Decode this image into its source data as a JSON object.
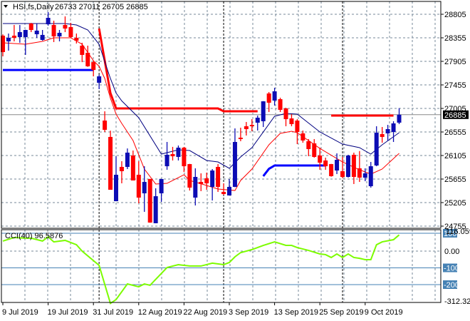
{
  "header": {
    "symbol": "HSI,fs,Daily",
    "ohlc": "26733 27011 26705 26885"
  },
  "cci_label": "CCI(40) 96.5876",
  "colors": {
    "bull": "#0c0cb4",
    "bear": "#ff0000",
    "ma_slow": "#000080",
    "ma_fast": "#ff0000",
    "cci": "#7cfc00",
    "level": "#4682b4",
    "grid": "#778899"
  },
  "chart_data": [
    {
      "type": "candlestick",
      "title": "HSI,fs,Daily",
      "yaxis_ticks": [
        28805,
        28355,
        27905,
        27455,
        27005,
        26555,
        26105,
        25655,
        25205,
        24755
      ],
      "ylim": [
        24755,
        28805
      ],
      "current_price": "26885",
      "grid": true,
      "x_tick_labels": [
        [
          "2019-07-09",
          "9 Jul 2019"
        ],
        [
          "2019-07-19",
          "19 Jul 2019"
        ],
        [
          "2019-07-31",
          "31 Jul 2019"
        ],
        [
          "2019-08-12",
          "12 Aug 2019"
        ],
        [
          "2019-08-22",
          "22 Aug 2019"
        ],
        [
          "2019-09-03",
          "3 Sep 2019"
        ],
        [
          "2019-09-13",
          "13 Sep 2019"
        ],
        [
          "2019-09-25",
          "25 Sep 2019"
        ],
        [
          "2019-10-09",
          "9 Oct 2019"
        ]
      ],
      "period_separators": [
        "2019-08-01",
        "2019-09-02",
        "2019-10-02"
      ],
      "candles_ohlc": [
        [
          "2019-07-09",
          28396,
          28420,
          28000,
          28082
        ],
        [
          "2019-07-10",
          28287,
          28437,
          28110,
          28355
        ],
        [
          "2019-07-11",
          28396,
          28600,
          28287,
          28355
        ],
        [
          "2019-07-12",
          28369,
          28600,
          28260,
          28464
        ],
        [
          "2019-07-15",
          28369,
          28510,
          28028,
          28505
        ],
        [
          "2019-07-16",
          28628,
          28640,
          28464,
          28505
        ],
        [
          "2019-07-17",
          28423,
          28628,
          28355,
          28492
        ],
        [
          "2019-07-18",
          28314,
          28505,
          28300,
          28410
        ],
        [
          "2019-07-19",
          28614,
          28846,
          28587,
          28737
        ],
        [
          "2019-07-22",
          28600,
          28682,
          28273,
          28382
        ],
        [
          "2019-07-23",
          28382,
          28505,
          28287,
          28450
        ],
        [
          "2019-07-24",
          28600,
          28764,
          28464,
          28532
        ],
        [
          "2019-07-25",
          28560,
          28640,
          28355,
          28369
        ],
        [
          "2019-07-26",
          28355,
          28437,
          28246,
          28300
        ],
        [
          "2019-07-29",
          28205,
          28260,
          27890,
          28028
        ],
        [
          "2019-07-30",
          28069,
          28205,
          27800,
          27810
        ],
        [
          "2019-07-31",
          27890,
          27918,
          27618,
          27740
        ],
        [
          "2019-08-01",
          27495,
          27650,
          27373,
          27618
        ],
        [
          "2019-08-02",
          26773,
          26950,
          26555,
          26596
        ],
        [
          "2019-08-05",
          26460,
          26580,
          25450,
          25450
        ],
        [
          "2019-08-06",
          25232,
          26090,
          25230,
          25737
        ],
        [
          "2019-08-07",
          25887,
          25996,
          25573,
          25805
        ],
        [
          "2019-08-08",
          25887,
          26240,
          25846,
          26160
        ],
        [
          "2019-08-09",
          26105,
          26200,
          25628,
          25628
        ],
        [
          "2019-08-12",
          25737,
          25996,
          25191,
          25300
        ],
        [
          "2019-08-13",
          25382,
          25900,
          25028,
          25600
        ],
        [
          "2019-08-14",
          25655,
          25660,
          24820,
          24823
        ],
        [
          "2019-08-15",
          24810,
          25478,
          24810,
          25327
        ],
        [
          "2019-08-16",
          25382,
          25660,
          25218,
          25655
        ],
        [
          "2019-08-19",
          25900,
          26364,
          25832,
          26119
        ],
        [
          "2019-08-20",
          26132,
          26270,
          26010,
          26091
        ],
        [
          "2019-08-21",
          26078,
          26296,
          26010,
          26255
        ],
        [
          "2019-08-22",
          26255,
          26270,
          25790,
          25900
        ],
        [
          "2019-08-23",
          25941,
          25945,
          25436,
          25491
        ],
        [
          "2019-08-26",
          25300,
          25860,
          25150,
          25696
        ],
        [
          "2019-08-27",
          25600,
          25764,
          25423,
          25560
        ],
        [
          "2019-08-28",
          25669,
          25778,
          25450,
          25573
        ],
        [
          "2019-08-29",
          25505,
          25846,
          25245,
          25818
        ],
        [
          "2019-08-30",
          25887,
          25941,
          25409,
          25505
        ],
        [
          "2019-09-02",
          25409,
          25573,
          25355,
          25368
        ],
        [
          "2019-09-03",
          25341,
          25655,
          25341,
          25505
        ],
        [
          "2019-09-04",
          25505,
          26623,
          25500,
          26364
        ],
        [
          "2019-09-05",
          26446,
          26637,
          26378,
          26419
        ],
        [
          "2019-09-06",
          26664,
          26746,
          26487,
          26610
        ],
        [
          "2019-09-09",
          26691,
          26800,
          26569,
          26664
        ],
        [
          "2019-09-10",
          26732,
          26869,
          26582,
          26828
        ],
        [
          "2019-09-11",
          26760,
          27145,
          26650,
          27141
        ],
        [
          "2019-09-12",
          27291,
          27318,
          26937,
          27114
        ],
        [
          "2019-09-13",
          27155,
          27400,
          27060,
          27332
        ],
        [
          "2019-09-16",
          27182,
          27210,
          26937,
          26978
        ],
        [
          "2019-09-17",
          27005,
          27019,
          26664,
          26800
        ],
        [
          "2019-09-18",
          26814,
          26896,
          26664,
          26705
        ],
        [
          "2019-09-19",
          26773,
          26800,
          26323,
          26555
        ],
        [
          "2019-09-20",
          26528,
          26582,
          26350,
          26392
        ],
        [
          "2019-09-23",
          26378,
          26419,
          26092,
          26228
        ],
        [
          "2019-09-24",
          26337,
          26419,
          26064,
          26078
        ],
        [
          "2019-09-25",
          26105,
          26255,
          25832,
          25968
        ],
        [
          "2019-09-26",
          26010,
          26064,
          25832,
          25900
        ],
        [
          "2019-09-27",
          25941,
          25945,
          25700,
          25710
        ],
        [
          "2019-09-30",
          25818,
          26146,
          25750,
          26023
        ],
        [
          "2019-10-02",
          25805,
          26078,
          25669,
          25696
        ],
        [
          "2019-10-03",
          25696,
          26119,
          25683,
          26105
        ],
        [
          "2019-10-04",
          26119,
          26160,
          25560,
          25696
        ],
        [
          "2019-10-08",
          25860,
          26190,
          25600,
          25682
        ],
        [
          "2019-10-09",
          25682,
          25860,
          25614,
          25764
        ],
        [
          "2019-10-10",
          25518,
          25982,
          25491,
          25900
        ],
        [
          "2019-10-11",
          25914,
          26664,
          25900,
          26541
        ],
        [
          "2019-10-14",
          26514,
          26650,
          26350,
          26460
        ],
        [
          "2019-10-15",
          26528,
          26691,
          26392,
          26610
        ],
        [
          "2019-10-16",
          26555,
          26760,
          26364,
          26719
        ],
        [
          "2019-10-17",
          26733,
          27011,
          26705,
          26885
        ]
      ],
      "lines": [
        {
          "color": "#000080",
          "points": [
            [
              "2019-07-09",
              28628
            ],
            [
              "2019-07-24",
              28628
            ],
            [
              "2019-07-26",
              28600
            ],
            [
              "2019-07-30",
              28505
            ],
            [
              "2019-08-01",
              28232
            ],
            [
              "2019-08-02",
              27900
            ],
            [
              "2019-08-05",
              27578
            ],
            [
              "2019-08-06",
              27300
            ],
            [
              "2019-08-07",
              27150
            ],
            [
              "2019-08-12",
              26828
            ],
            [
              "2019-08-16",
              26132
            ],
            [
              "2019-08-21",
              26214
            ],
            [
              "2019-08-23",
              26200
            ],
            [
              "2019-08-28",
              26010
            ],
            [
              "2019-08-30",
              25982
            ],
            [
              "2019-09-03",
              25860
            ],
            [
              "2019-09-05",
              26078
            ],
            [
              "2019-09-09",
              26255
            ],
            [
              "2019-09-13",
              26855
            ],
            [
              "2019-09-17",
              26910
            ],
            [
              "2019-09-19",
              26896
            ],
            [
              "2019-09-25",
              26555
            ],
            [
              "2019-10-02",
              26323
            ],
            [
              "2019-10-08",
              26255
            ],
            [
              "2019-10-10",
              26132
            ],
            [
              "2019-10-14",
              26310
            ],
            [
              "2019-10-17",
              26541
            ]
          ]
        },
        {
          "color": "#ff0000",
          "points": [
            [
              "2019-07-09",
              28260
            ],
            [
              "2019-07-15",
              28232
            ],
            [
              "2019-07-18",
              28287
            ],
            [
              "2019-07-22",
              28355
            ],
            [
              "2019-07-25",
              28355
            ],
            [
              "2019-07-29",
              28232
            ],
            [
              "2019-07-31",
              27918
            ],
            [
              "2019-08-01",
              27810
            ],
            [
              "2019-08-02",
              27578
            ],
            [
              "2019-08-05",
              27200
            ],
            [
              "2019-08-06",
              26896
            ],
            [
              "2019-08-07",
              26719
            ],
            [
              "2019-08-09",
              26391
            ],
            [
              "2019-08-13",
              25846
            ],
            [
              "2019-08-15",
              25560
            ],
            [
              "2019-08-19",
              25573
            ],
            [
              "2019-08-22",
              25737
            ],
            [
              "2019-08-23",
              25628
            ],
            [
              "2019-08-28",
              25532
            ],
            [
              "2019-08-30",
              25464
            ],
            [
              "2019-09-04",
              25436
            ],
            [
              "2019-09-05",
              25628
            ],
            [
              "2019-09-09",
              25846
            ],
            [
              "2019-09-12",
              26310
            ],
            [
              "2019-09-16",
              26528
            ],
            [
              "2019-09-18",
              26569
            ],
            [
              "2019-09-19",
              26541
            ],
            [
              "2019-09-25",
              26241
            ],
            [
              "2019-10-02",
              25982
            ],
            [
              "2019-10-08",
              25832
            ],
            [
              "2019-10-10",
              25750
            ],
            [
              "2019-10-14",
              25846
            ],
            [
              "2019-10-17",
              26146
            ]
          ]
        }
      ],
      "levels": [
        {
          "color": "#ff0000",
          "points": [
            [
              "2019-08-01",
              28532
            ],
            [
              "2019-08-05",
              27300
            ],
            [
              "2019-08-06",
              27005
            ],
            [
              "2019-08-30",
              27005
            ],
            [
              "2019-09-02",
              26950
            ],
            [
              "2019-09-10",
              26950
            ]
          ]
        },
        {
          "color": "#ff0000",
          "points": [
            [
              "2019-09-27",
              26869
            ],
            [
              "2019-10-16",
              26869
            ]
          ]
        },
        {
          "color": "#0000ff",
          "points": [
            [
              "2019-07-09",
              27740
            ],
            [
              "2019-07-31",
              27740
            ]
          ]
        },
        {
          "color": "#0000ff",
          "points": [
            [
              "2019-09-11",
              25710
            ],
            [
              "2019-09-12",
              25850
            ],
            [
              "2019-09-13",
              25914
            ],
            [
              "2019-09-26",
              25914
            ]
          ]
        }
      ]
    },
    {
      "type": "line",
      "title": "CCI(40) 96.5876",
      "ylim": [
        -312.32,
        116.0594
      ],
      "yaxis_labels": [
        "116.0594",
        "0.00",
        "-312.32"
      ],
      "levels": [
        [
          "100",
          "100"
        ],
        [
          "-100",
          "-100"
        ],
        [
          "-200",
          "-200"
        ]
      ],
      "series": [
        {
          "points": [
            [
              "2019-07-09",
              60
            ],
            [
              "2019-07-11",
              81
            ],
            [
              "2019-07-15",
              77
            ],
            [
              "2019-07-16",
              77
            ],
            [
              "2019-07-18",
              60
            ],
            [
              "2019-07-19",
              85
            ],
            [
              "2019-07-22",
              55
            ],
            [
              "2019-07-24",
              64
            ],
            [
              "2019-07-26",
              38
            ],
            [
              "2019-07-29",
              0
            ],
            [
              "2019-08-01",
              -85
            ],
            [
              "2019-08-05",
              -312
            ],
            [
              "2019-08-06",
              -289
            ],
            [
              "2019-08-08",
              -196
            ],
            [
              "2019-08-12",
              -213
            ],
            [
              "2019-08-13",
              -196
            ],
            [
              "2019-08-14",
              -204
            ],
            [
              "2019-08-19",
              -98
            ],
            [
              "2019-08-21",
              -81
            ],
            [
              "2019-08-23",
              -89
            ],
            [
              "2019-08-27",
              -89
            ],
            [
              "2019-08-29",
              -72
            ],
            [
              "2019-09-02",
              -81
            ],
            [
              "2019-09-03",
              -68
            ],
            [
              "2019-09-04",
              -34
            ],
            [
              "2019-09-05",
              -9
            ],
            [
              "2019-09-09",
              9
            ],
            [
              "2019-09-11",
              34
            ],
            [
              "2019-09-13",
              55
            ],
            [
              "2019-09-17",
              34
            ],
            [
              "2019-09-18",
              34
            ],
            [
              "2019-09-19",
              21
            ],
            [
              "2019-09-23",
              4
            ],
            [
              "2019-09-25",
              -17
            ],
            [
              "2019-09-26",
              -21
            ],
            [
              "2019-09-27",
              -38
            ],
            [
              "2019-09-30",
              -17
            ],
            [
              "2019-10-02",
              -38
            ],
            [
              "2019-10-03",
              -17
            ],
            [
              "2019-10-04",
              -38
            ],
            [
              "2019-10-08",
              -43
            ],
            [
              "2019-10-09",
              -51
            ],
            [
              "2019-10-10",
              -51
            ],
            [
              "2019-10-11",
              38
            ],
            [
              "2019-10-14",
              55
            ],
            [
              "2019-10-16",
              68
            ],
            [
              "2019-10-17",
              96.59
            ]
          ]
        }
      ]
    }
  ]
}
